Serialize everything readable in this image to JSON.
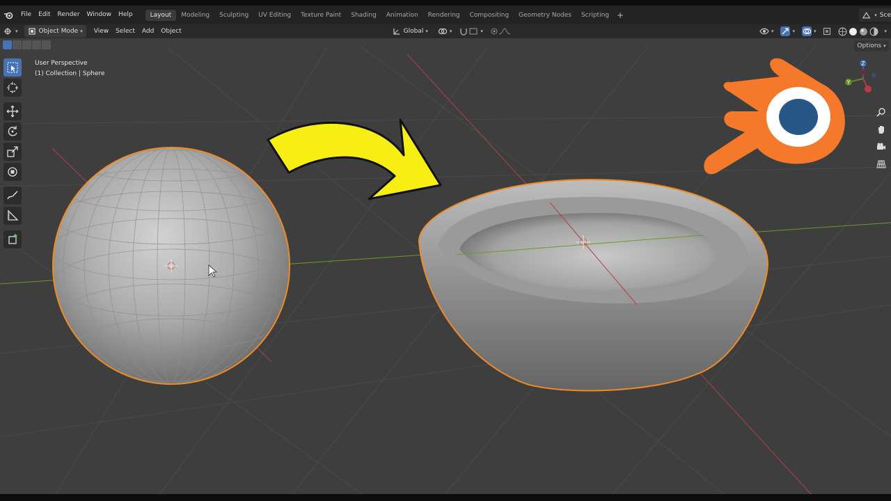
{
  "menubar": {
    "items": [
      "File",
      "Edit",
      "Render",
      "Window",
      "Help"
    ],
    "tabs": [
      "Layout",
      "Modeling",
      "Sculpting",
      "UV Editing",
      "Texture Paint",
      "Shading",
      "Animation",
      "Rendering",
      "Compositing",
      "Geometry Nodes",
      "Scripting"
    ],
    "active_tab": "Layout",
    "add_tab": "+",
    "scene_label": "Sce"
  },
  "header": {
    "mode": "Object Mode",
    "menus": [
      "View",
      "Select",
      "Add",
      "Object"
    ],
    "transform_orientation": "Global"
  },
  "viewport": {
    "view_name": "User Perspective",
    "collection_info": "(1) Collection | Sphere",
    "options_label": "Options",
    "gizmo": {
      "z": "Z",
      "y": "Y"
    }
  },
  "colors": {
    "accent": "#4772b3",
    "selection_outline": "#f08a24",
    "arrow": "#f7ee13",
    "blender_orange": "#f5792a",
    "blender_blue": "#265787",
    "axis_x": "#c8404a",
    "axis_y": "#6a9a2a"
  },
  "icons": [
    "blender-logo-icon",
    "editor-type-icon",
    "object-mode-icon",
    "global-orientation-icon",
    "pivot-icon",
    "snap-icon",
    "proportional-edit-icon",
    "visibility-icon",
    "gizmo-icon",
    "overlay-icon",
    "xray-icon",
    "shading-wireframe-icon",
    "shading-solid-icon",
    "shading-material-icon",
    "shading-rendered-icon",
    "select-box-icon",
    "cursor-icon",
    "move-icon",
    "rotate-icon",
    "scale-icon",
    "transform-icon",
    "annotate-icon",
    "measure-icon",
    "add-cube-icon",
    "zoom-icon",
    "hand-icon",
    "camera-icon",
    "grid-icon"
  ]
}
